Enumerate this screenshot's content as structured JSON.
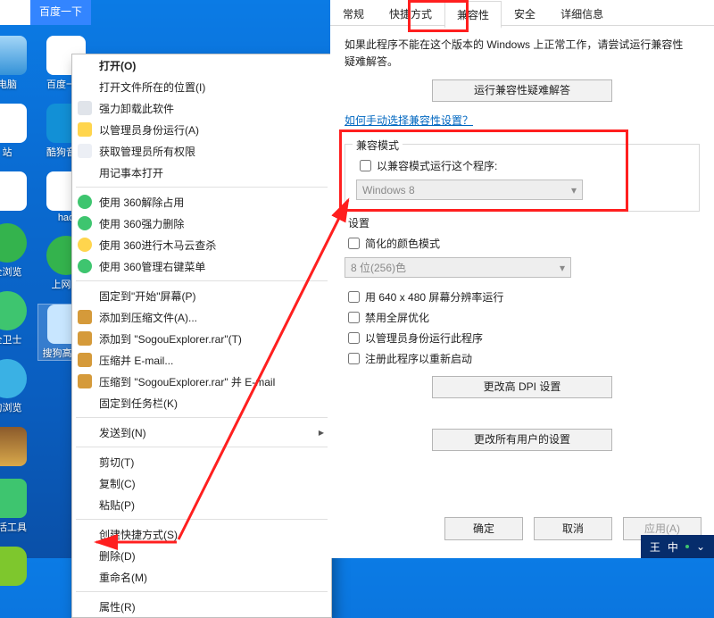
{
  "desktop": {
    "col1": [
      {
        "label": "电脑",
        "cls": "pc"
      },
      {
        "label": "站",
        "cls": "baidu"
      },
      {
        "label": "",
        "cls": "hao"
      },
      {
        "label": "全浏览",
        "cls": "net"
      },
      {
        "label": "全卫士",
        "cls": "safe"
      },
      {
        "label": "狗浏览",
        "cls": "ie"
      },
      {
        "label": "",
        "cls": "rar"
      },
      {
        "label": "激活工具",
        "cls": "jh"
      },
      {
        "label": "",
        "cls": "yi"
      }
    ],
    "col2": [
      {
        "label": "百度一下",
        "cls": "baidu"
      },
      {
        "label": "酷狗音乐",
        "cls": "kg"
      },
      {
        "label": "hao",
        "cls": "hao"
      },
      {
        "label": "上网…",
        "cls": "net"
      },
      {
        "label": "搜狗高…器",
        "cls": "sg",
        "selected": true
      }
    ]
  },
  "baidu": {
    "btn": "百度一下"
  },
  "menu": {
    "rows": [
      {
        "label": "打开(O)",
        "bold": true
      },
      {
        "label": "打开文件所在的位置(I)"
      },
      {
        "label": "强力卸载此软件",
        "icon": "del"
      },
      {
        "label": "以管理员身份运行(A)",
        "icon": "shield"
      },
      {
        "label": "获取管理员所有权限",
        "icon": "key"
      },
      {
        "label": "用记事本打开"
      },
      {
        "sep": true
      },
      {
        "label": "使用 360解除占用",
        "icon": "g360"
      },
      {
        "label": "使用 360强力删除",
        "icon": "g360"
      },
      {
        "label": "使用 360进行木马云查杀",
        "icon": "y360"
      },
      {
        "label": "使用 360管理右键菜单",
        "icon": "g360"
      },
      {
        "sep": true
      },
      {
        "label": "固定到\"开始\"屏幕(P)"
      },
      {
        "label": "添加到压缩文件(A)...",
        "icon": "rar"
      },
      {
        "label": "添加到 \"SogouExplorer.rar\"(T)",
        "icon": "rar"
      },
      {
        "label": "压缩并 E-mail...",
        "icon": "rar"
      },
      {
        "label": "压缩到 \"SogouExplorer.rar\" 并 E-mail",
        "icon": "rar"
      },
      {
        "label": "固定到任务栏(K)"
      },
      {
        "sep": true
      },
      {
        "label": "发送到(N)",
        "arrow": true
      },
      {
        "sep": true
      },
      {
        "label": "剪切(T)"
      },
      {
        "label": "复制(C)"
      },
      {
        "label": "粘贴(P)"
      },
      {
        "sep": true
      },
      {
        "label": "创建快捷方式(S)"
      },
      {
        "label": "删除(D)"
      },
      {
        "label": "重命名(M)"
      },
      {
        "sep": true
      },
      {
        "label": "属性(R)"
      }
    ]
  },
  "dlg": {
    "tabs": [
      "常规",
      "快捷方式",
      "兼容性",
      "安全",
      "详细信息"
    ],
    "active_tab": 2,
    "note": "如果此程序不能在这个版本的 Windows 上正常工作，请尝试运行兼容性疑难解答。",
    "btn_trouble": "运行兼容性疑难解答",
    "help_link": "如何手动选择兼容性设置？",
    "group_compat": {
      "legend": "兼容模式",
      "chk": "以兼容模式运行这个程序:",
      "dd_value": "Windows 8"
    },
    "group_settings": {
      "legend": "设置",
      "color_chk": "简化的颜色模式",
      "color_dd": "8 位(256)色",
      "chk_640": "用 640 x 480 屏幕分辨率运行",
      "chk_fullsc": "禁用全屏优化",
      "chk_admin": "以管理员身份运行此程序",
      "chk_restart": "注册此程序以重新启动",
      "btn_dpi": "更改高 DPI 设置"
    },
    "btn_allusers": "更改所有用户的设置",
    "btn_ok": "确定",
    "btn_cancel": "取消",
    "btn_apply": "应用(A)"
  },
  "taskbar": {
    "king": "王",
    "ch": "中"
  }
}
